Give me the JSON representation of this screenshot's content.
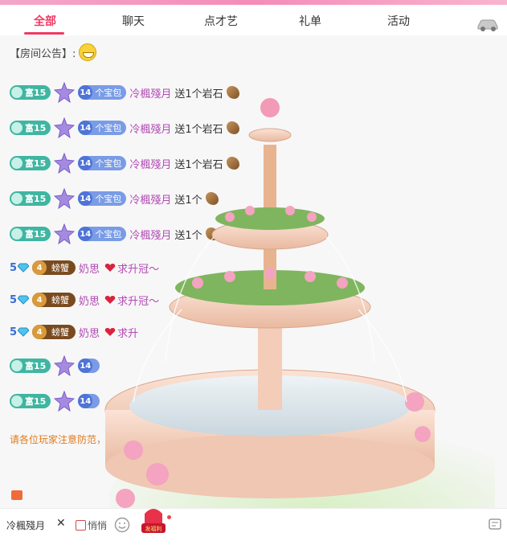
{
  "tabs": [
    {
      "label": "全部",
      "active": true
    },
    {
      "label": "聊天",
      "active": false
    },
    {
      "label": "点才艺",
      "active": false
    },
    {
      "label": "礼单",
      "active": false
    },
    {
      "label": "活动",
      "active": false
    }
  ],
  "icons": {
    "car": "car-icon",
    "emoji": "grinning-emoji-icon",
    "horn": "horn-icon",
    "smile": "smile-icon",
    "edit": "edit-icon"
  },
  "colors": {
    "accent": "#ef3a62",
    "username": "#b24ab5",
    "notice": "#e07b1e",
    "fu_badge": "#3fb6a1",
    "pkg_badge": "#7a9ce6"
  },
  "announcement": {
    "label": "【房间公告】:"
  },
  "gift_rows": [
    {
      "fu": "富15",
      "pkg_level": "14",
      "pkg": "个宝包",
      "user": "冷楓殘月",
      "msg": "送1个岩石"
    },
    {
      "fu": "富15",
      "pkg_level": "14",
      "pkg": "个宝包",
      "user": "冷楓殘月",
      "msg": "送1个岩石"
    },
    {
      "fu": "富15",
      "pkg_level": "14",
      "pkg": "个宝包",
      "user": "冷楓殘月",
      "msg": "送1个岩石"
    },
    {
      "fu": "富15",
      "pkg_level": "14",
      "pkg": "个宝包",
      "user": "冷楓殘月",
      "msg": "送1个"
    },
    {
      "fu": "富15",
      "pkg_level": "14",
      "pkg": "个宝包",
      "user": "冷楓殘月",
      "msg": "送1个"
    }
  ],
  "crab_rows": [
    {
      "level": "5",
      "crab_level": "4",
      "crab": "螃蟹",
      "user": "奶思",
      "msg": "求升冠～"
    },
    {
      "level": "5",
      "crab_level": "4",
      "crab": "螃蟹",
      "user": "奶思",
      "msg": "求升冠～"
    },
    {
      "level": "5",
      "crab_level": "4",
      "crab": "螃蟹",
      "user": "奶思",
      "msg": "求升"
    }
  ],
  "tail_rows": [
    {
      "fu": "富15",
      "pkg_level": "14"
    },
    {
      "fu": "富15",
      "pkg_level": "14"
    }
  ],
  "notice": "请各位玩家注意防范，",
  "bottom": {
    "target_user": "冷楓殘月",
    "close": "✕",
    "whisper": "悄悄",
    "gift_label": "发福利"
  }
}
